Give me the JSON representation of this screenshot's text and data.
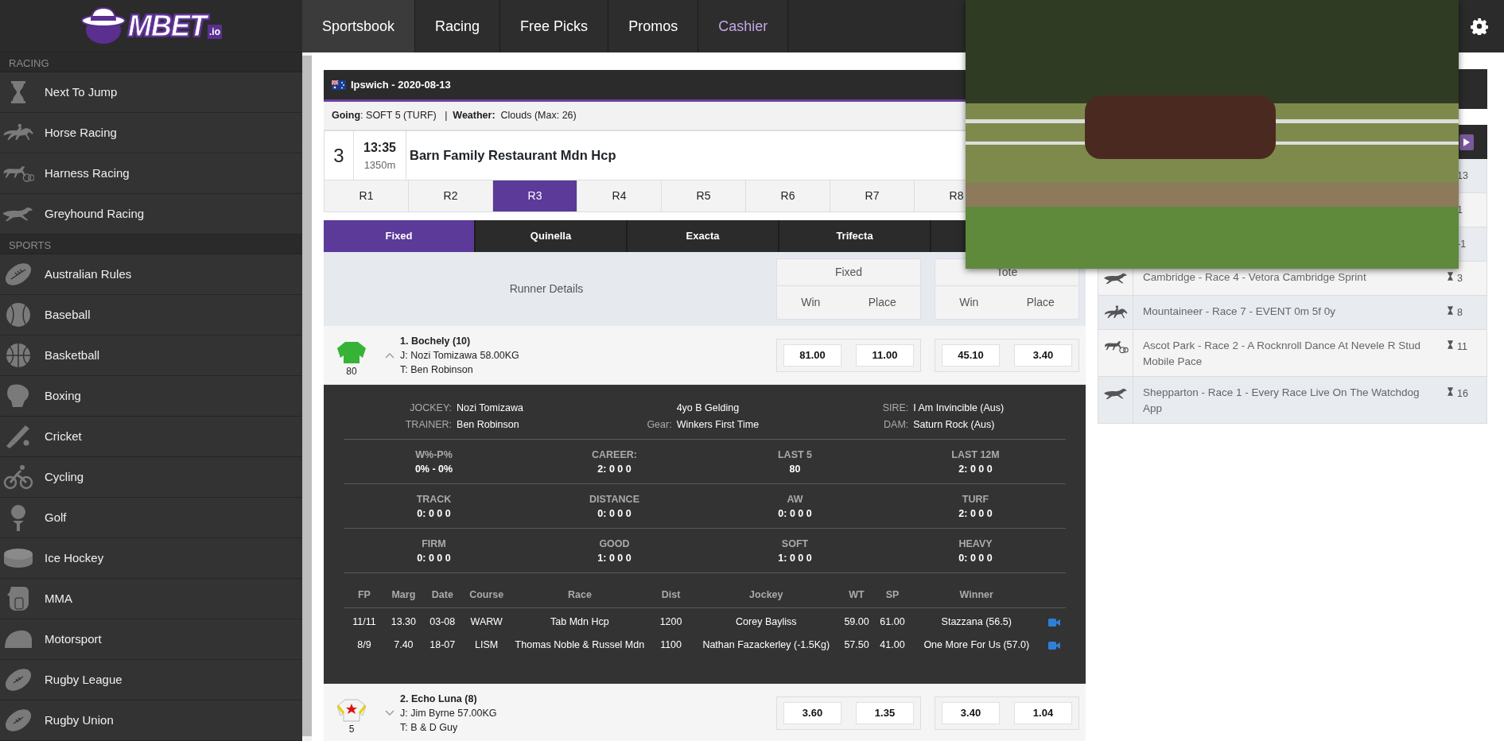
{
  "logo": {
    "text": "MBET",
    "suffix": ".io"
  },
  "nav": [
    {
      "label": "Sportsbook",
      "selected": true,
      "accent": false
    },
    {
      "label": "Racing",
      "selected": false,
      "accent": false
    },
    {
      "label": "Free Picks",
      "selected": false,
      "accent": false
    },
    {
      "label": "Promos",
      "selected": false,
      "accent": false
    },
    {
      "label": "Cashier",
      "selected": false,
      "accent": true
    }
  ],
  "sidebar": [
    {
      "title": "RACING",
      "items": [
        {
          "label": "Next To Jump",
          "kind": "hourglass"
        },
        {
          "label": "Horse Racing",
          "kind": "horse"
        },
        {
          "label": "Harness Racing",
          "kind": "harness"
        },
        {
          "label": "Greyhound Racing",
          "kind": "greyhound"
        }
      ]
    },
    {
      "title": "SPORTS",
      "items": [
        {
          "label": "Australian Rules",
          "kind": "oval"
        },
        {
          "label": "Baseball",
          "kind": "baseball"
        },
        {
          "label": "Basketball",
          "kind": "basketball"
        },
        {
          "label": "Boxing",
          "kind": "boxing"
        },
        {
          "label": "Cricket",
          "kind": "cricket"
        },
        {
          "label": "Cycling",
          "kind": "cycling"
        },
        {
          "label": "Golf",
          "kind": "golf"
        },
        {
          "label": "Ice Hockey",
          "kind": "puck"
        },
        {
          "label": "MMA",
          "kind": "mma"
        },
        {
          "label": "Motorsport",
          "kind": "helmet"
        },
        {
          "label": "Rugby League",
          "kind": "rugby"
        },
        {
          "label": "Rugby Union",
          "kind": "rugby"
        }
      ]
    }
  ],
  "race": {
    "title": "Ipswich - 2020-08-13",
    "conditions": "**Going**: SOFT 5 (TURF)   |  **Weather:**  Clouds (Max: 26)",
    "number": "3",
    "time": "13:35",
    "distance": "1350m",
    "name": "Barn Family Restaurant Mdn Hcp",
    "race_tabs": [
      {
        "label": "R1",
        "selected": false
      },
      {
        "label": "R2",
        "selected": false
      },
      {
        "label": "R3",
        "selected": true
      },
      {
        "label": "R4",
        "selected": false
      },
      {
        "label": "R5",
        "selected": false
      },
      {
        "label": "R6",
        "selected": false
      },
      {
        "label": "R7",
        "selected": false
      },
      {
        "label": "R8",
        "selected": false
      }
    ],
    "bet_tabs": [
      {
        "label": "Fixed",
        "selected": true
      },
      {
        "label": "Quinella",
        "selected": false
      },
      {
        "label": "Exacta",
        "selected": false
      },
      {
        "label": "Trifecta",
        "selected": false
      }
    ],
    "runner_header": {
      "title": "Runner Details",
      "groups": [
        {
          "title": "Fixed",
          "win": "Win",
          "place": "Place"
        },
        {
          "title": "Tote",
          "win": "Win",
          "place": "Place"
        }
      ]
    },
    "runners": [
      {
        "name": "1. Bochely (10)",
        "jockey": "J: Nozi Tomizawa 58.00KG",
        "trainer": "T: Ben Robinson",
        "rating": "80",
        "kind": "solid",
        "color": "#36b336",
        "expanded": true,
        "odds": [
          "81.00",
          "11.00",
          "45.10",
          "3.40"
        ],
        "details": {
          "info": [
            [
              {
                "label": "JOCKEY:",
                "value": "Nozi Tomizawa"
              },
              {
                "label": "TRAINER:",
                "value": "Ben Robinson"
              }
            ],
            [
              {
                "value": "4yo B Gelding"
              },
              {
                "label": "Gear:",
                "value": "Winkers First Time"
              }
            ],
            [
              {
                "label": "SIRE:",
                "value": "I Am Invincible (Aus)"
              },
              {
                "label": "DAM:",
                "value": "Saturn Rock (Aus)"
              }
            ]
          ],
          "stats": [
            {
              "label": "W%-P%",
              "value": "0% - 0%"
            },
            {
              "label": "CAREER:",
              "value": "2: 0 0 0"
            },
            {
              "label": "LAST 5",
              "value": "80"
            },
            {
              "label": "LAST 12M",
              "value": "2: 0 0 0"
            },
            {
              "label": "TRACK",
              "value": "0: 0 0 0"
            },
            {
              "label": "DISTANCE",
              "value": "0: 0 0 0"
            },
            {
              "label": "AW",
              "value": "0: 0 0 0"
            },
            {
              "label": "TURF",
              "value": "2: 0 0 0"
            },
            {
              "label": "FIRM",
              "value": "0: 0 0 0"
            },
            {
              "label": "GOOD",
              "value": "1: 0 0 0"
            },
            {
              "label": "SOFT",
              "value": "1: 0 0 0"
            },
            {
              "label": "HEAVY",
              "value": "0: 0 0 0"
            }
          ],
          "form_columns": [
            "FP",
            "Marg",
            "Date",
            "Course",
            "Race",
            "Dist",
            "Jockey",
            "WT",
            "SP",
            "Winner"
          ],
          "form_rows": [
            {
              "cells": [
                "11/11",
                "13.30",
                "03-08",
                "WARW",
                "Tab Mdn Hcp",
                "1200",
                "Corey Bayliss",
                "59.00",
                "61.00",
                "Stazzana (56.5)"
              ],
              "video": true
            },
            {
              "cells": [
                "8/9",
                "7.40",
                "18-07",
                "LISM",
                "Thomas Noble & Russel Mdn",
                "1100",
                "Nathan Fazackerley (-1.5Kg)",
                "57.50",
                "41.00",
                "One More For Us (57.0)"
              ],
              "video": true
            }
          ]
        }
      },
      {
        "name": "2. Echo Luna (8)",
        "jockey": "J: Jim Byrne 57.00KG",
        "trainer": "T: B & D Guy",
        "rating": "5",
        "kind": "star",
        "expanded": false,
        "odds": [
          "3.60",
          "1.35",
          "3.40",
          "1.04"
        ]
      }
    ]
  },
  "next_races": [
    {
      "countdown": "13"
    },
    {
      "countdown": "1"
    },
    {
      "countdown": "-1"
    },
    {
      "kind": "greyhound",
      "name": "Cambridge - Race 4 - Vetora Cambridge Sprint",
      "countdown": "3"
    },
    {
      "kind": "horse",
      "name": "Mountaineer - Race 7 - EVENT 0m 5f 0y",
      "countdown": "8"
    },
    {
      "kind": "harness",
      "name": "Ascot Park - Race 2 - A Rocknroll Dance At Nevele R Stud Mobile Pace",
      "countdown": "11"
    },
    {
      "kind": "greyhound",
      "name": "Shepparton - Race 1 - Every Race Live On The Watchdog App",
      "countdown": "16"
    }
  ]
}
